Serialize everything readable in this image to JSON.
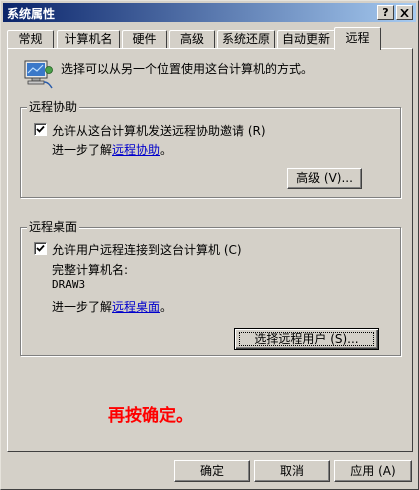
{
  "window": {
    "title": "系统属性",
    "help_button": "?",
    "close_button": "X"
  },
  "tabs": [
    {
      "label": "常规"
    },
    {
      "label": "计算机名"
    },
    {
      "label": "硬件"
    },
    {
      "label": "高级"
    },
    {
      "label": "系统还原"
    },
    {
      "label": "自动更新"
    },
    {
      "label": "远程"
    }
  ],
  "active_tab": "远程",
  "intro": {
    "icon": "network-computer-icon",
    "text": "选择可以从另一个位置使用这台计算机的方式。"
  },
  "remote_assistance": {
    "title": "远程协助",
    "checkbox_label": "允许从这台计算机发送远程协助邀请 (R)",
    "checked": true,
    "learn_more_prefix": "进一步了解",
    "learn_more_link": "远程协助",
    "learn_more_suffix": "。",
    "advanced_button": "高级 (V)..."
  },
  "remote_desktop": {
    "title": "远程桌面",
    "checkbox_label": "允许用户远程连接到这台计算机 (C)",
    "checked": true,
    "computer_name_label": "完整计算机名:",
    "computer_name_value": "DRAW3",
    "learn_more_prefix": "进一步了解",
    "learn_more_link": "远程桌面",
    "learn_more_suffix": "。",
    "select_users_button": "选择远程用户 (S)..."
  },
  "annotation": {
    "text": "再按确定。",
    "color": "#ff0000"
  },
  "footer": {
    "ok": "确定",
    "cancel": "取消",
    "apply": "应用 (A)"
  },
  "colors": {
    "title_gradient_start": "#0a246a",
    "title_gradient_end": "#a6caf0",
    "face": "#d4d0c8",
    "link": "#0000cc"
  }
}
